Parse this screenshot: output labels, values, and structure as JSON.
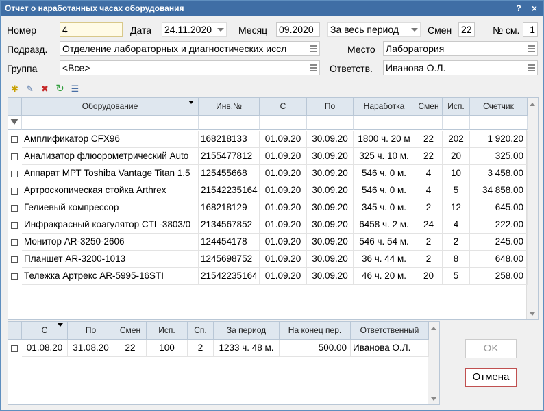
{
  "window": {
    "title": "Отчет о наработанных часах оборудования",
    "help": "?",
    "close": "×"
  },
  "form": {
    "nomer_label": "Номер",
    "nomer_value": "4",
    "data_label": "Дата",
    "data_value": "24.11.2020",
    "mesyac_label": "Месяц",
    "mesyac_value": "09.2020",
    "period_value": "За весь период",
    "smen_label": "Смен",
    "smen_value": "22",
    "nsm_label": "№ см.",
    "nsm_value": "1",
    "podrazd_label": "Подразд.",
    "podrazd_value": "Отделение лабораторных и диагностических иссл",
    "mesto_label": "Место",
    "mesto_value": "Лаборатория",
    "gruppa_label": "Группа",
    "gruppa_value": "<Все>",
    "otv_label": "Ответств.",
    "otv_value": "Иванова О.Л."
  },
  "main_grid": {
    "columns": [
      "Оборудование",
      "Инв.№",
      "С",
      "По",
      "Наработка",
      "Смен",
      "Исп.",
      "Счетчик"
    ],
    "rows": [
      [
        "Амплификатор CFX96",
        "168218133",
        "01.09.20",
        "30.09.20",
        "1800 ч. 20 м",
        "22",
        "202",
        "1 920.20"
      ],
      [
        "Анализатор флюорометрический Auto",
        "2155477812",
        "01.09.20",
        "30.09.20",
        "325 ч. 10 м.",
        "22",
        "20",
        "325.00"
      ],
      [
        "Аппарат МРТ Toshiba Vantage Titan 1.5",
        "125455668",
        "01.09.20",
        "30.09.20",
        "546 ч. 0 м.",
        "4",
        "10",
        "3 458.00"
      ],
      [
        "Артроскопическая стойка Arthrex",
        "21542235164",
        "01.09.20",
        "30.09.20",
        "546 ч. 0 м.",
        "4",
        "5",
        "34 858.00"
      ],
      [
        "Гелиевый компрессор",
        "168218129",
        "01.09.20",
        "30.09.20",
        "345 ч. 0 м.",
        "2",
        "12",
        "645.00"
      ],
      [
        "Инфракрасный коагулятор CTL-3803/0",
        "2134567852",
        "01.09.20",
        "30.09.20",
        "6458 ч. 2 м.",
        "24",
        "4",
        "222.00"
      ],
      [
        "Монитор AR-3250-2606",
        "124454178",
        "01.09.20",
        "30.09.20",
        "546 ч. 54 м.",
        "2",
        "2",
        "245.00"
      ],
      [
        "Планшет AR-3200-1013",
        "1245698752",
        "01.09.20",
        "30.09.20",
        "36 ч. 44 м.",
        "2",
        "8",
        "648.00"
      ],
      [
        "Тележка Артрекс AR-5995-16STI",
        "21542235164",
        "01.09.20",
        "30.09.20",
        "46 ч. 20 м.",
        "20",
        "5",
        "258.00"
      ]
    ]
  },
  "sub_grid": {
    "columns": [
      "С",
      "По",
      "Смен",
      "Исп.",
      "Сп.",
      "За период",
      "На конец пер.",
      "Ответственный"
    ],
    "rows": [
      [
        "01.08.20",
        "31.08.20",
        "22",
        "100",
        "2",
        "1233 ч. 48 м.",
        "500.00",
        "Иванова О.Л."
      ]
    ]
  },
  "buttons": {
    "ok": "OK",
    "cancel": "Отмена"
  }
}
